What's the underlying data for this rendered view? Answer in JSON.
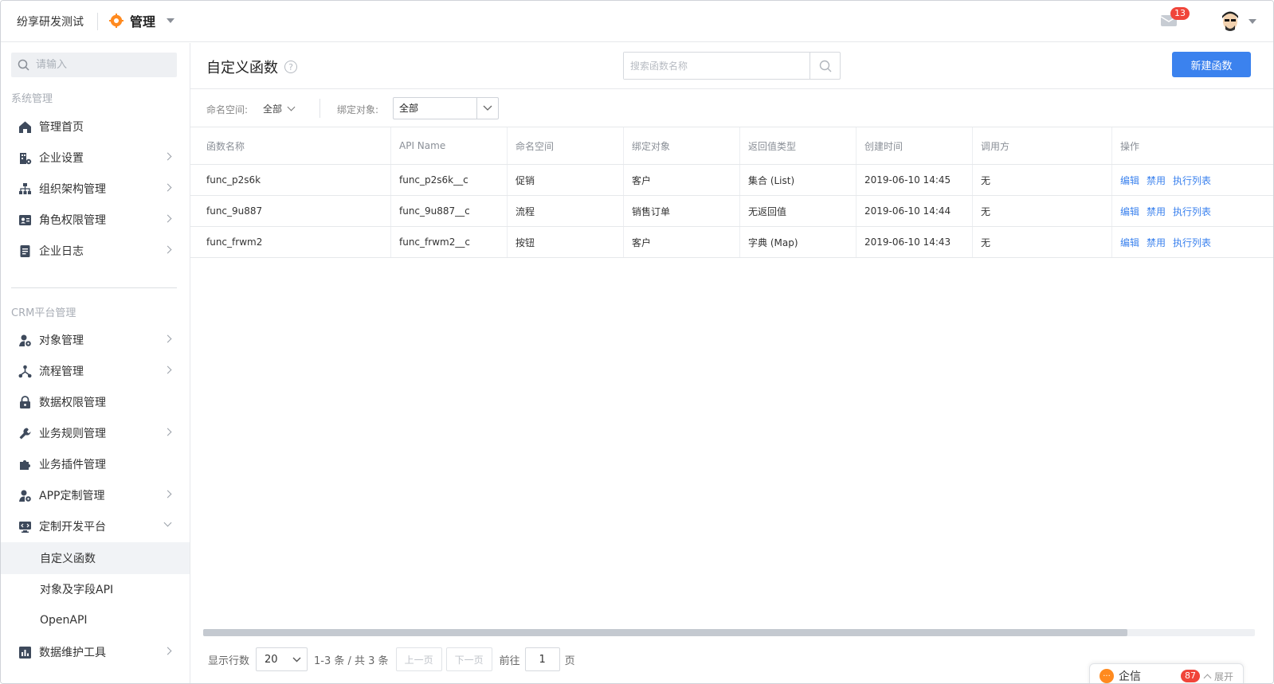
{
  "header": {
    "company": "纷享研发测试",
    "app_title": "管理",
    "mail_count": "13",
    "colors": {
      "accent": "#3b82ee",
      "badge": "#f0453a",
      "brand": "#ff8a1f"
    }
  },
  "sidebar": {
    "search_placeholder": "请输入",
    "group1_title": "系统管理",
    "group1_items": [
      {
        "label": "管理首页",
        "icon": "home-icon"
      },
      {
        "label": "企业设置",
        "icon": "enterprise-icon"
      },
      {
        "label": "组织架构管理",
        "icon": "org-icon"
      },
      {
        "label": "角色权限管理",
        "icon": "role-icon"
      },
      {
        "label": "企业日志",
        "icon": "log-icon"
      }
    ],
    "group2_title": "CRM平台管理",
    "group2_items": [
      {
        "label": "对象管理",
        "icon": "object-icon"
      },
      {
        "label": "流程管理",
        "icon": "flow-icon"
      },
      {
        "label": "数据权限管理",
        "icon": "lock-icon"
      },
      {
        "label": "业务规则管理",
        "icon": "wrench-icon"
      },
      {
        "label": "业务插件管理",
        "icon": "plugin-icon"
      },
      {
        "label": "APP定制管理",
        "icon": "app-icon"
      },
      {
        "label": "定制开发平台",
        "icon": "dev-icon"
      }
    ],
    "sub_items": [
      "自定义函数",
      "对象及字段API",
      "OpenAPI"
    ],
    "last_item": {
      "label": "数据维护工具",
      "icon": "chart-icon"
    }
  },
  "main": {
    "title": "自定义函数",
    "search_placeholder": "搜索函数名称",
    "new_button": "新建函数",
    "filter": {
      "namespace_label": "命名空间:",
      "namespace_value": "全部",
      "binding_label": "绑定对象:",
      "binding_value": "全部"
    },
    "table": {
      "columns": [
        "函数名称",
        "API Name",
        "命名空间",
        "绑定对象",
        "返回值类型",
        "创建时间",
        "调用方",
        "操作"
      ],
      "rows": [
        [
          "func_p2s6k",
          "func_p2s6k__c",
          "促销",
          "客户",
          "集合 (List)",
          "2019-06-10 14:45",
          "无"
        ],
        [
          "func_9u887",
          "func_9u887__c",
          "流程",
          "销售订单",
          "无返回值",
          "2019-06-10 14:44",
          "无"
        ],
        [
          "func_frwm2",
          "func_frwm2__c",
          "按钮",
          "客户",
          "字典 (Map)",
          "2019-06-10 14:43",
          "无"
        ]
      ],
      "ops": [
        "编辑",
        "禁用",
        "执行列表"
      ]
    },
    "pager": {
      "rows_label": "显示行数",
      "rows_value": "20",
      "summary": "1-3 条 / 共 3 条",
      "prev": "上一页",
      "next": "下一页",
      "goto": "前往",
      "page": "1",
      "page_unit": "页"
    }
  },
  "qixin": {
    "label": "企信",
    "count": "87",
    "expand": "展开"
  }
}
